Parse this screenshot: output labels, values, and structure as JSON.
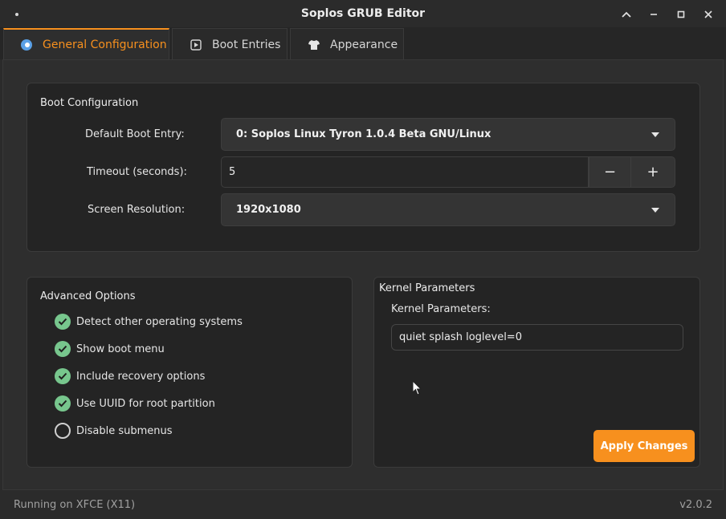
{
  "window": {
    "title": "Soplos GRUB Editor",
    "controls": [
      "chevron-up-icon",
      "minimize-icon",
      "maximize-icon",
      "close-icon"
    ]
  },
  "tabs": [
    {
      "label": "General Configuration",
      "icon": "toggle-icon",
      "active": true
    },
    {
      "label": "Boot Entries",
      "icon": "play-box-icon",
      "active": false
    },
    {
      "label": "Appearance",
      "icon": "shirt-icon",
      "active": false
    }
  ],
  "boot_config": {
    "title": "Boot Configuration",
    "default_entry_label": "Default Boot Entry:",
    "default_entry_value": "0: Soplos Linux Tyron 1.0.4 Beta GNU/Linux",
    "timeout_label": "Timeout (seconds):",
    "timeout_value": "5",
    "decrement": "−",
    "increment": "+",
    "resolution_label": "Screen Resolution:",
    "resolution_value": "1920x1080"
  },
  "advanced": {
    "title": "Advanced Options",
    "options": [
      {
        "label": "Detect other operating systems",
        "checked": true
      },
      {
        "label": "Show boot menu",
        "checked": true
      },
      {
        "label": "Include recovery options",
        "checked": true
      },
      {
        "label": "Use UUID for root partition",
        "checked": true
      },
      {
        "label": "Disable submenus",
        "checked": false
      }
    ]
  },
  "kernel": {
    "frame_title": "Kernel Parameters",
    "field_label": "Kernel Parameters:",
    "value": "quiet splash loglevel=0"
  },
  "apply_label": "Apply Changes",
  "status": {
    "left": "Running on XFCE (X11)",
    "right": "v2.0.2"
  },
  "colors": {
    "accent": "#f7901e",
    "check_on": "#77c68d"
  }
}
